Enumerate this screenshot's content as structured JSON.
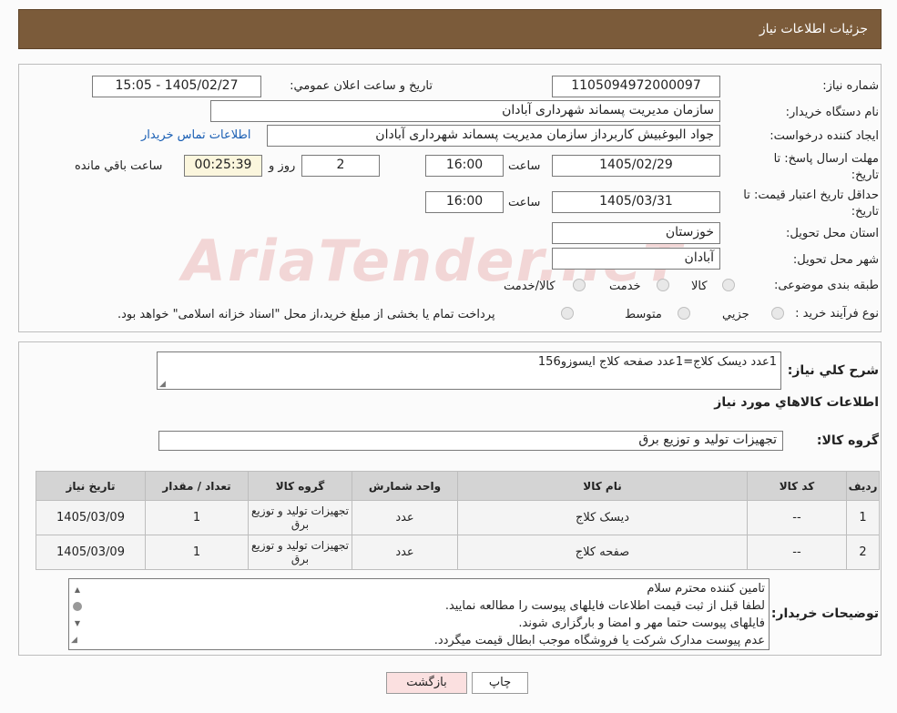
{
  "header": {
    "title": "جزئیات اطلاعات نیاز"
  },
  "form": {
    "need_number_label": "شماره نیاز:",
    "need_number": "1105094972000097",
    "announce_label": "تاریخ و ساعت اعلان عمومي:",
    "announce_value": "1405/02/27 - 15:05",
    "buyer_org_label": "نام دستگاه خریدار:",
    "buyer_org": "سازمان مدیریت پسماند شهرداری آبادان",
    "requester_label": "ایجاد کننده درخواست:",
    "requester": "جواد البوغبیش کاربرداز سازمان مدیریت پسماند شهرداری آبادان",
    "contact_link": "اطلاعات تماس خریدار",
    "deadline_label": "مهلت ارسال پاسخ: تا تاریخ:",
    "deadline_date": "1405/02/29",
    "hour_label": "ساعت",
    "deadline_time": "16:00",
    "days_value": "2",
    "days_label": "روز و",
    "remaining_time": "00:25:39",
    "remaining_label": "ساعت باقي مانده",
    "validity_label": "حداقل تاریخ اعتبار قیمت: تا تاریخ:",
    "validity_date": "1405/03/31",
    "validity_time": "16:00",
    "province_label": "استان محل تحویل:",
    "province": "خوزستان",
    "city_label": "شهر محل تحویل:",
    "city": "آبادان",
    "category_label": "طبقه بندی موضوعی:",
    "category_options": [
      "کالا",
      "خدمت",
      "کالا/خدمت"
    ],
    "process_label": "نوع فرآیند خرید :",
    "process_options": [
      "جزیي",
      "متوسط"
    ],
    "process_note": "پرداخت تمام یا بخشی از مبلغ خرید،از محل \"اسناد خزانه اسلامی\" خواهد بود."
  },
  "summary": {
    "label": "شرح کلي نیاز:",
    "text": "1عدد دیسک کلاج=1عدد صفحه کلاج ایسوزو156",
    "goods_info_title": "اطلاعات کالاهاي مورد نیاز",
    "group_label": "گروه کالا:",
    "group_value": "تجهیزات تولید و توزیع برق"
  },
  "table": {
    "headers": [
      "ردیف",
      "کد کالا",
      "نام کالا",
      "واحد شمارش",
      "گروه کالا",
      "تعداد / مقدار",
      "تاریخ نیاز"
    ],
    "rows": [
      [
        "1",
        "--",
        "دیسک کلاج",
        "عدد",
        "تجهیزات تولید و توزیع برق",
        "1",
        "1405/03/09"
      ],
      [
        "2",
        "--",
        "صفحه کلاج",
        "عدد",
        "تجهیزات تولید و توزیع برق",
        "1",
        "1405/03/09"
      ]
    ]
  },
  "buyer_notes": {
    "label": "توضیحات خریدار:",
    "lines": [
      "تامین کننده محترم سلام",
      "لطفا قبل از ثبت قیمت اطلاعات فایلهای پیوست را مطالعه نمایید.",
      "فایلهای پیوست حتما مهر و امضا و بارگزاری شوند.",
      "عدم پیوست مدارک شرکت یا فروشگاه موجب ابطال قیمت میگردد."
    ]
  },
  "buttons": {
    "print": "چاپ",
    "back": "بازگشت"
  },
  "watermark": "AriaTender.neT"
}
